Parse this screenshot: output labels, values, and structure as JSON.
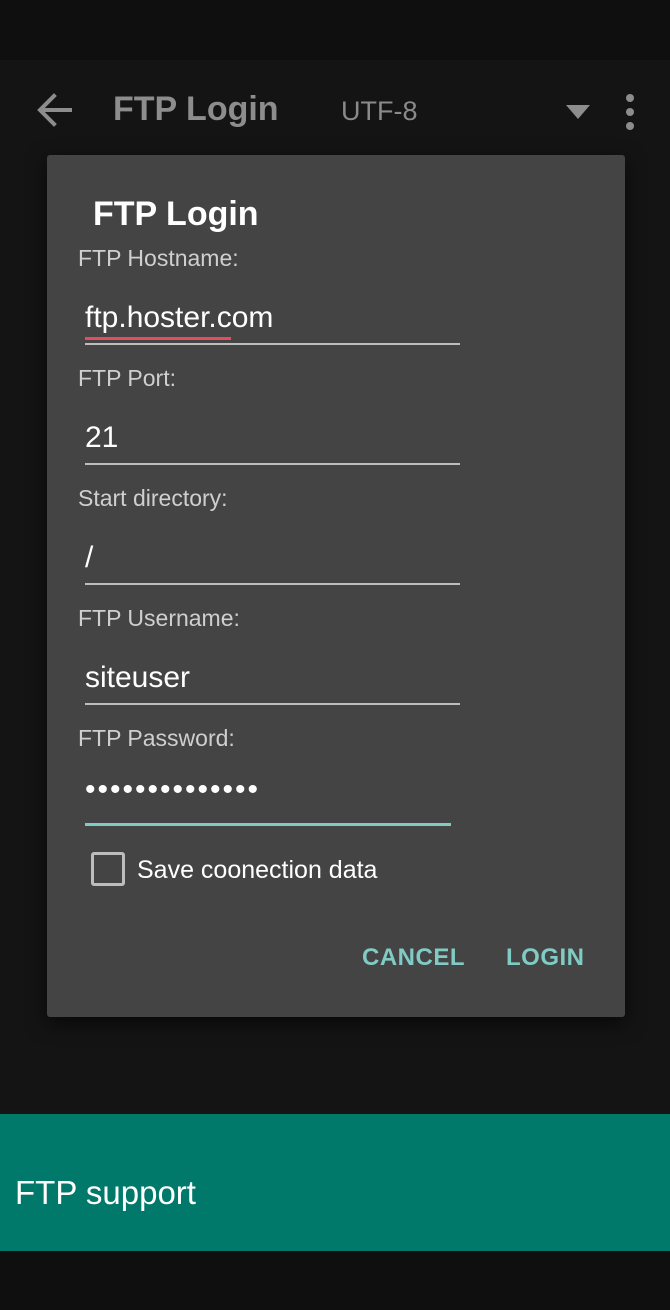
{
  "appbar": {
    "title": "FTP Login",
    "encoding": "UTF-8",
    "icons": [
      "arrow-back-icon",
      "dropdown-arrow-icon",
      "more-vert-icon"
    ]
  },
  "dialog": {
    "title": "FTP Login",
    "fields": [
      {
        "label": "FTP Hostname:",
        "value": "ftp.hoster.com"
      },
      {
        "label": "FTP Port:",
        "value": "21"
      },
      {
        "label": "Start directory:",
        "value": "/"
      },
      {
        "label": "FTP Username:",
        "value": "siteuser"
      },
      {
        "label": "FTP Password:",
        "value": "••••••••••••••"
      }
    ],
    "save_label": "Save coonection data",
    "cancel_label": "CANCEL",
    "login_label": "LOGIN"
  },
  "banner": {
    "text": "FTP support"
  },
  "colors": {
    "accent": "#80cbc4",
    "banner": "#00796b",
    "dialog": "#444444",
    "spell_underline": "#e84a5f"
  }
}
